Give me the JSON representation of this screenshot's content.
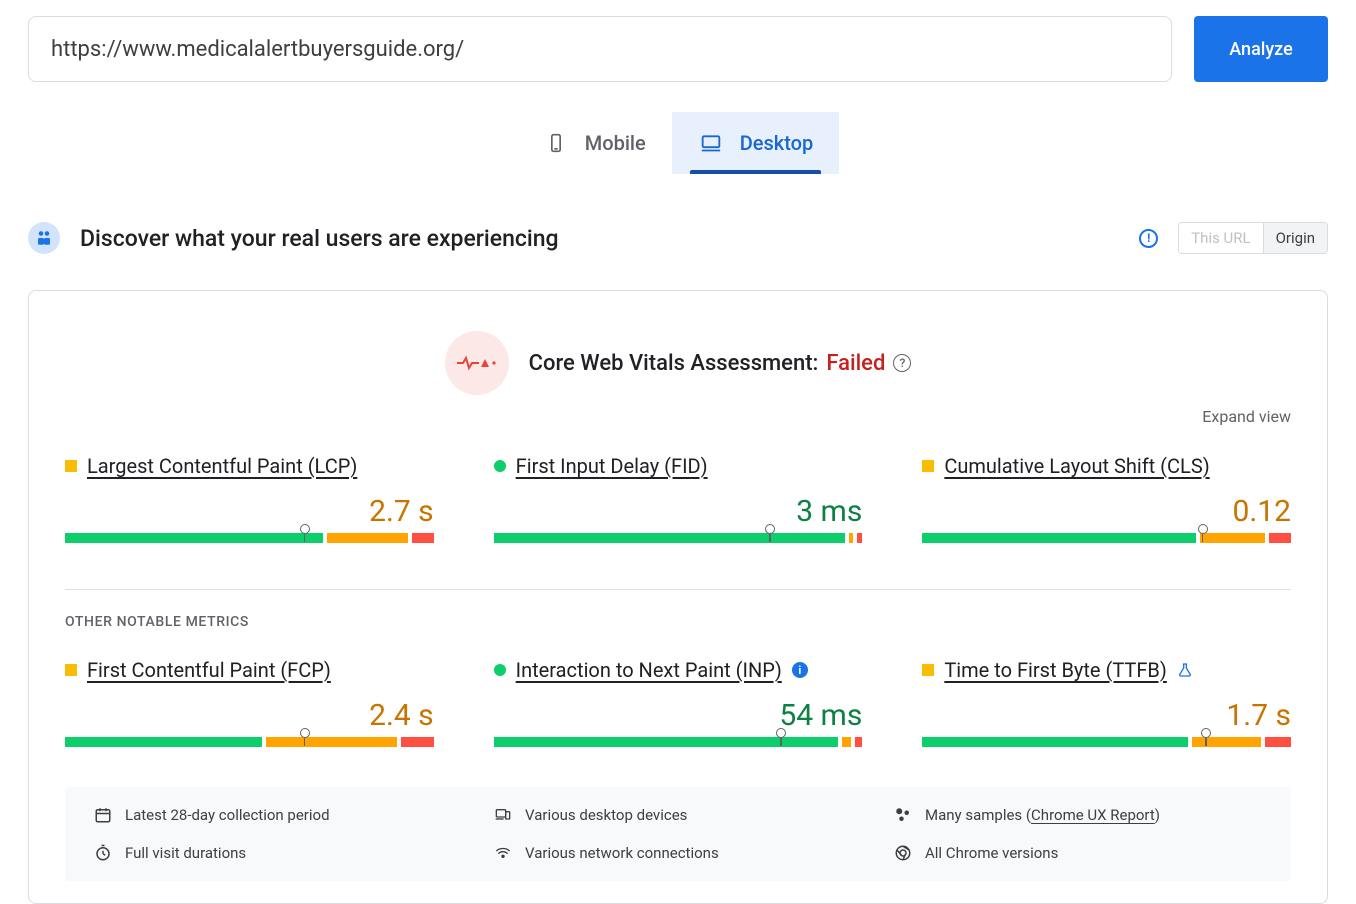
{
  "url_input": {
    "value": "https://www.medicalalertbuyersguide.org/"
  },
  "analyze_label": "Analyze",
  "tabs": {
    "mobile": "Mobile",
    "desktop": "Desktop",
    "active": "desktop"
  },
  "section": {
    "title": "Discover what your real users are experiencing",
    "scope": {
      "url": "This URL",
      "origin": "Origin",
      "active": "origin"
    }
  },
  "assessment": {
    "label": "Core Web Vitals Assessment: ",
    "status": "Failed"
  },
  "expand_label": "Expand view",
  "metrics_top": [
    {
      "name": "Largest Contentful Paint (LCP)",
      "status_shape": "square",
      "status_color": "orange",
      "value": "2.7 s",
      "value_color": "orange",
      "segments": [
        70,
        22,
        6
      ],
      "marker": 65
    },
    {
      "name": "First Input Delay (FID)",
      "status_shape": "circle",
      "status_color": "green",
      "value": "3 ms",
      "value_color": "green",
      "segments": [
        97,
        1,
        1.5
      ],
      "marker": 75
    },
    {
      "name": "Cumulative Layout Shift (CLS)",
      "status_shape": "square",
      "status_color": "orange",
      "value": "0.12",
      "value_color": "orange",
      "segments": [
        75,
        18,
        6
      ],
      "marker": 76
    }
  ],
  "other_section_label": "OTHER NOTABLE METRICS",
  "metrics_bottom": [
    {
      "name": "First Contentful Paint (FCP)",
      "status_shape": "square",
      "status_color": "orange",
      "value": "2.4 s",
      "value_color": "orange",
      "extra": null,
      "segments": [
        54,
        36,
        9
      ],
      "marker": 65
    },
    {
      "name": "Interaction to Next Paint (INP)",
      "status_shape": "circle",
      "status_color": "green",
      "value": "54 ms",
      "value_color": "green",
      "extra": "info",
      "segments": [
        95,
        2.5,
        2
      ],
      "marker": 78
    },
    {
      "name": "Time to First Byte (TTFB)",
      "status_shape": "square",
      "status_color": "orange",
      "value": "1.7 s",
      "value_color": "orange",
      "extra": "flask",
      "segments": [
        73,
        19,
        7
      ],
      "marker": 77
    }
  ],
  "footer": {
    "period": "Latest 28-day collection period",
    "devices": "Various desktop devices",
    "samples_prefix": "Many samples (",
    "samples_link": "Chrome UX Report",
    "samples_suffix": ")",
    "durations": "Full visit durations",
    "network": "Various network connections",
    "versions": "All Chrome versions"
  }
}
